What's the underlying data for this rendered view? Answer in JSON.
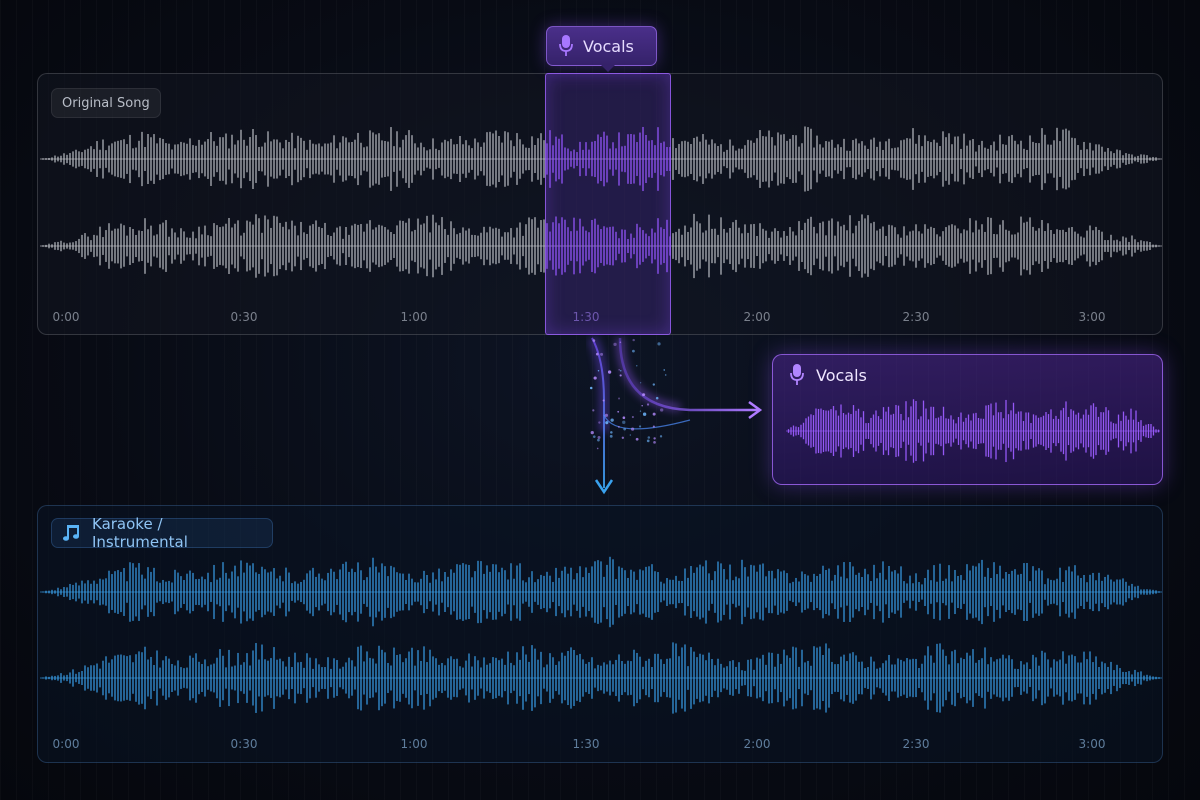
{
  "original": {
    "label": "Original Song",
    "timestamps": [
      "0:00",
      "0:30",
      "1:00",
      "1:30",
      "2:00",
      "2:30",
      "3:00"
    ]
  },
  "selection": {
    "label": "Vocals",
    "icon": "microphone-icon"
  },
  "vocals_output": {
    "label": "Vocals",
    "icon": "microphone-icon"
  },
  "karaoke": {
    "label": "Karaoke / Instrumental",
    "icon": "music-note-icon",
    "timestamps": [
      "0:00",
      "0:30",
      "1:00",
      "1:30",
      "2:00",
      "2:30",
      "3:00"
    ]
  },
  "colors": {
    "original_wave": "#c9ccd2",
    "vocals_accent": "#9b5cff",
    "karaoke_wave": "#3aa2ee"
  }
}
